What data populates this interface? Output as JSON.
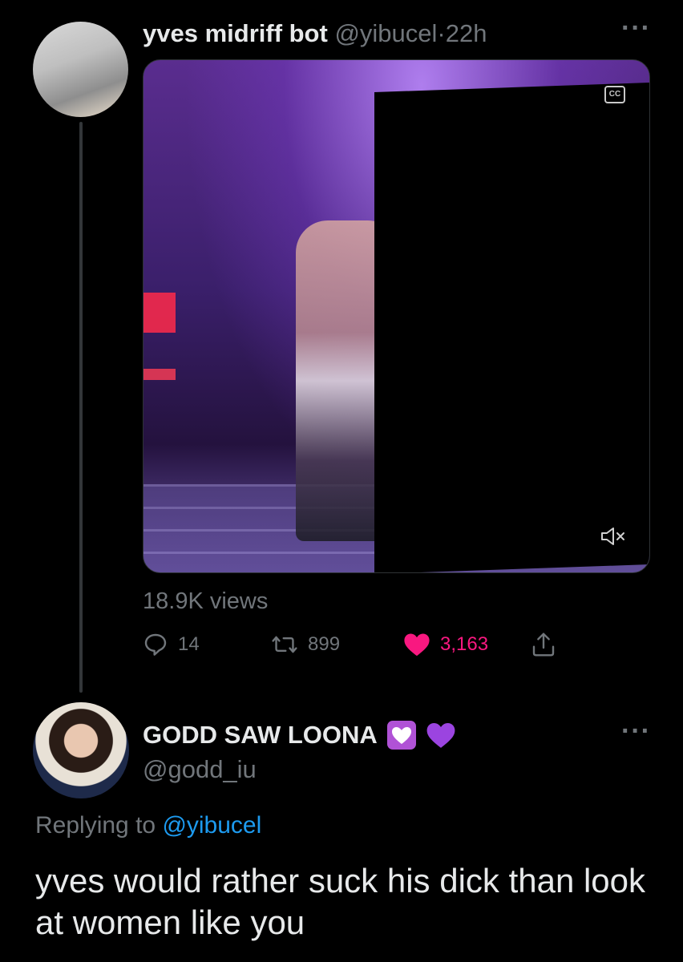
{
  "tweet": {
    "author_name": "yves midriff bot",
    "author_handle": "@yibucel",
    "separator": "·",
    "time": "22h",
    "media": {
      "cc_label": "CC"
    },
    "views": "18.9K views",
    "reply_count": "14",
    "retweet_count": "899",
    "like_count": "3,163",
    "like_color": "#f91880"
  },
  "reply": {
    "author_name": "GODD SAW LOONA",
    "author_handle": "@godd_iu",
    "replying_prefix": "Replying to",
    "replying_mention": "@yibucel",
    "text": "yves would rather suck his dick than look at women like you",
    "mention_color": "#1d9bf0"
  },
  "icons": {
    "more": "more-icon",
    "reply": "reply-icon",
    "retweet": "retweet-icon",
    "like": "heart-icon",
    "share": "share-icon",
    "mute": "mute-icon",
    "captions": "captions-icon"
  }
}
